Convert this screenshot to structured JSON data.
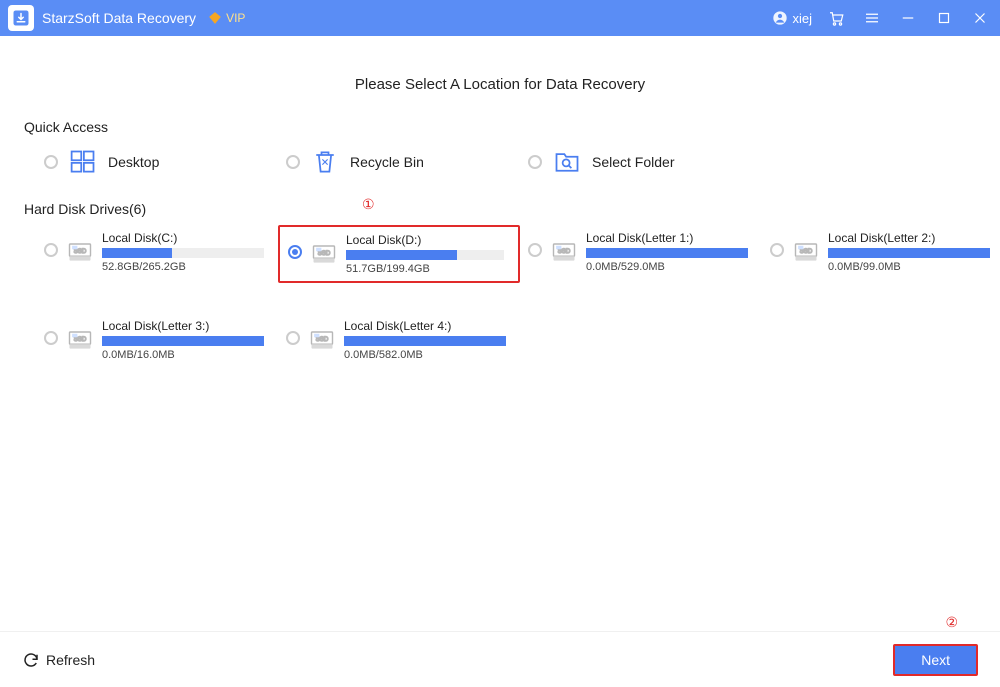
{
  "app": {
    "title": "StarzSoft Data Recovery",
    "vip_label": "VIP",
    "username": "xiej"
  },
  "page": {
    "heading": "Please Select A Location for Data Recovery"
  },
  "quick_access": {
    "label": "Quick Access",
    "items": [
      {
        "label": "Desktop",
        "icon": "windows-desktop-icon"
      },
      {
        "label": "Recycle Bin",
        "icon": "recycle-bin-icon"
      },
      {
        "label": "Select Folder",
        "icon": "folder-search-icon"
      }
    ]
  },
  "drives": {
    "label": "Hard Disk Drives(6)",
    "items": [
      {
        "name": "Local Disk(C:)",
        "stats": "52.8GB/265.2GB",
        "fill": 43,
        "type": "ssd",
        "selected": false
      },
      {
        "name": "Local Disk(D:)",
        "stats": "51.7GB/199.4GB",
        "fill": 70,
        "type": "ssd",
        "selected": true
      },
      {
        "name": "Local Disk(Letter 1:)",
        "stats": "0.0MB/529.0MB",
        "fill": 100,
        "type": "ssd",
        "selected": false
      },
      {
        "name": "Local Disk(Letter 2:)",
        "stats": "0.0MB/99.0MB",
        "fill": 100,
        "type": "ssd",
        "selected": false
      },
      {
        "name": "Local Disk(Letter 3:)",
        "stats": "0.0MB/16.0MB",
        "fill": 100,
        "type": "ssd",
        "selected": false
      },
      {
        "name": "Local Disk(Letter 4:)",
        "stats": "0.0MB/582.0MB",
        "fill": 100,
        "type": "ssd",
        "selected": false
      }
    ]
  },
  "footer": {
    "refresh_label": "Refresh",
    "next_label": "Next"
  },
  "annotations": {
    "marker1": "①",
    "marker2": "②"
  },
  "colors": {
    "accent": "#4a7ef0",
    "highlight": "#e12a2a",
    "titlebar": "#5a8df5"
  }
}
